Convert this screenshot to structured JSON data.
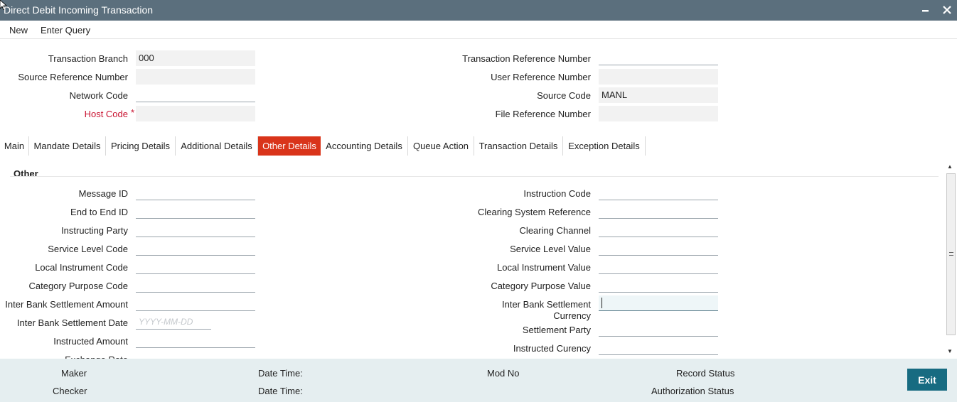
{
  "window": {
    "title": "Direct Debit Incoming Transaction"
  },
  "menu": {
    "new": "New",
    "enter_query": "Enter Query"
  },
  "header": {
    "transaction_branch": {
      "label": "Transaction Branch",
      "value": "000"
    },
    "source_reference_number": {
      "label": "Source Reference Number",
      "value": ""
    },
    "network_code": {
      "label": "Network Code",
      "value": ""
    },
    "host_code": {
      "label": "Host Code",
      "required": "*",
      "value": ""
    },
    "transaction_reference_number": {
      "label": "Transaction Reference Number",
      "value": ""
    },
    "user_reference_number": {
      "label": "User Reference Number",
      "value": ""
    },
    "source_code": {
      "label": "Source Code",
      "value": "MANL"
    },
    "file_reference_number": {
      "label": "File Reference Number",
      "value": ""
    }
  },
  "tabs": [
    {
      "label": "Main",
      "active": false
    },
    {
      "label": "Mandate Details",
      "active": false
    },
    {
      "label": "Pricing Details",
      "active": false
    },
    {
      "label": "Additional Details",
      "active": false
    },
    {
      "label": "Other Details",
      "active": true
    },
    {
      "label": "Accounting Details",
      "active": false
    },
    {
      "label": "Queue Action",
      "active": false
    },
    {
      "label": "Transaction Details",
      "active": false
    },
    {
      "label": "Exception Details",
      "active": false
    }
  ],
  "other": {
    "section_title": "Other",
    "message_id": {
      "label": "Message ID",
      "value": ""
    },
    "end_to_end_id": {
      "label": "End to End ID",
      "value": ""
    },
    "instructing_party": {
      "label": "Instructing Party",
      "value": ""
    },
    "service_level_code": {
      "label": "Service Level Code",
      "value": ""
    },
    "local_instrument_code": {
      "label": "Local Instrument Code",
      "value": ""
    },
    "category_purpose_code": {
      "label": "Category Purpose Code",
      "value": ""
    },
    "inter_bank_settlement_amount": {
      "label": "Inter Bank Settlement Amount",
      "value": ""
    },
    "inter_bank_settlement_date": {
      "label": "Inter Bank Settlement Date",
      "placeholder": "YYYY-MM-DD"
    },
    "instructed_amount": {
      "label": "Instructed Amount",
      "value": ""
    },
    "exchange_rate": {
      "label": "Exchange Rate"
    },
    "instruction_code": {
      "label": "Instruction Code",
      "value": ""
    },
    "clearing_system_reference": {
      "label": "Clearing System Reference",
      "value": ""
    },
    "clearing_channel": {
      "label": "Clearing Channel",
      "value": ""
    },
    "service_level_value": {
      "label": "Service Level Value",
      "value": ""
    },
    "local_instrument_value": {
      "label": "Local Instrument Value",
      "value": ""
    },
    "category_purpose_value": {
      "label": "Category Purpose Value",
      "value": ""
    },
    "inter_bank_settlement_currency": {
      "label_line1": "Inter Bank Settlement",
      "label_line2": "Currency",
      "value": ""
    },
    "settlement_party": {
      "label": "Settlement Party",
      "value": ""
    },
    "instructed_currency": {
      "label": "Instructed Curency",
      "value": ""
    }
  },
  "footer": {
    "maker": "Maker",
    "checker": "Checker",
    "date_time_1": "Date Time:",
    "date_time_2": "Date Time:",
    "mod_no": "Mod No",
    "record_status": "Record Status",
    "authorization_status": "Authorization Status",
    "exit": "Exit"
  },
  "icons": {
    "minimize": "minimize-icon",
    "close": "close-icon",
    "scroll_up": "scroll-up-arrow-icon",
    "scroll_down": "scroll-down-arrow-icon"
  },
  "colors": {
    "title_bar": "#5b6f7d",
    "active_tab": "#d9341a",
    "required": "#c8102e",
    "footer_bg": "#e5eef0",
    "exit_button": "#176b81"
  }
}
